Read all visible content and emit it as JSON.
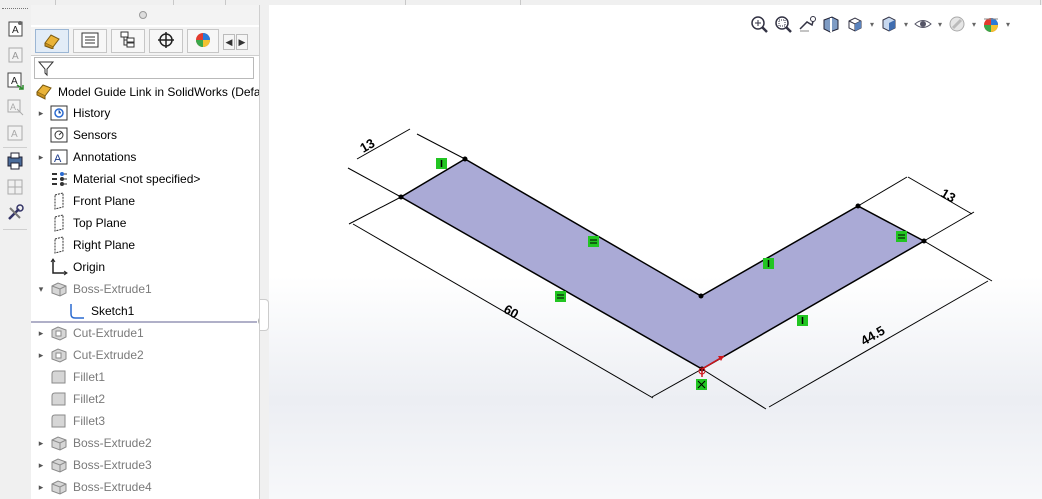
{
  "feature_manager": {
    "filter": {
      "placeholder": ""
    },
    "tabs": [
      {
        "name": "feature-manager-tab",
        "icon": "feature-tree-icon"
      },
      {
        "name": "property-manager-tab",
        "icon": "property-manager-icon"
      },
      {
        "name": "configuration-manager-tab",
        "icon": "configuration-manager-icon"
      },
      {
        "name": "dimxpert-manager-tab",
        "icon": "dimxpert-icon"
      },
      {
        "name": "display-manager-tab",
        "icon": "display-manager-icon"
      }
    ],
    "root": {
      "label": "Model Guide Link in SolidWorks  (Defa",
      "icon": "part-icon"
    },
    "items": [
      {
        "label": "History",
        "icon": "history-icon",
        "expandable": true,
        "greyed": false
      },
      {
        "label": "Sensors",
        "icon": "sensors-icon",
        "expandable": false,
        "greyed": false
      },
      {
        "label": "Annotations",
        "icon": "annotations-icon",
        "expandable": true,
        "greyed": false
      },
      {
        "label": "Material <not specified>",
        "icon": "material-icon",
        "expandable": false,
        "greyed": false
      },
      {
        "label": "Front Plane",
        "icon": "plane-icon",
        "expandable": false,
        "greyed": false
      },
      {
        "label": "Top Plane",
        "icon": "plane-icon",
        "expandable": false,
        "greyed": false
      },
      {
        "label": "Right Plane",
        "icon": "plane-icon",
        "expandable": false,
        "greyed": false
      },
      {
        "label": "Origin",
        "icon": "origin-icon",
        "expandable": false,
        "greyed": false
      },
      {
        "label": "Boss-Extrude1",
        "icon": "extrude-icon",
        "expandable": true,
        "expanded": true,
        "greyed": true
      },
      {
        "label": "Sketch1",
        "icon": "sketch-icon",
        "expandable": false,
        "greyed": false,
        "child": true
      },
      {
        "label": "Cut-Extrude1",
        "icon": "cut-extrude-icon",
        "expandable": true,
        "greyed": true
      },
      {
        "label": "Cut-Extrude2",
        "icon": "cut-extrude-icon",
        "expandable": true,
        "greyed": true
      },
      {
        "label": "Fillet1",
        "icon": "fillet-icon",
        "expandable": false,
        "greyed": true
      },
      {
        "label": "Fillet2",
        "icon": "fillet-icon",
        "expandable": false,
        "greyed": true
      },
      {
        "label": "Fillet3",
        "icon": "fillet-icon",
        "expandable": false,
        "greyed": true
      },
      {
        "label": "Boss-Extrude2",
        "icon": "extrude-icon",
        "expandable": true,
        "greyed": true
      },
      {
        "label": "Boss-Extrude3",
        "icon": "extrude-icon",
        "expandable": true,
        "greyed": true
      },
      {
        "label": "Boss-Extrude4",
        "icon": "extrude-icon",
        "expandable": true,
        "greyed": true
      }
    ]
  },
  "heads_up_toolbar": [
    "zoom-to-fit-icon",
    "zoom-to-area-icon",
    "previous-view-icon",
    "section-view-icon",
    "view-orientation-icon",
    "display-style-icon",
    "hide-show-items-icon",
    "edit-appearance-icon",
    "apply-scene-icon"
  ],
  "sketch": {
    "dimensions": {
      "dim_left_width": "13",
      "dim_right_width": "13",
      "dim_long": "60",
      "dim_short": "44.5"
    },
    "colors": {
      "fill": "#aaaad6",
      "line": "#000000",
      "relation": "#22c522",
      "origin": "#d0141a"
    }
  },
  "colors": {
    "accent": "#9bb6d4",
    "panel": "#f0f0f0"
  }
}
